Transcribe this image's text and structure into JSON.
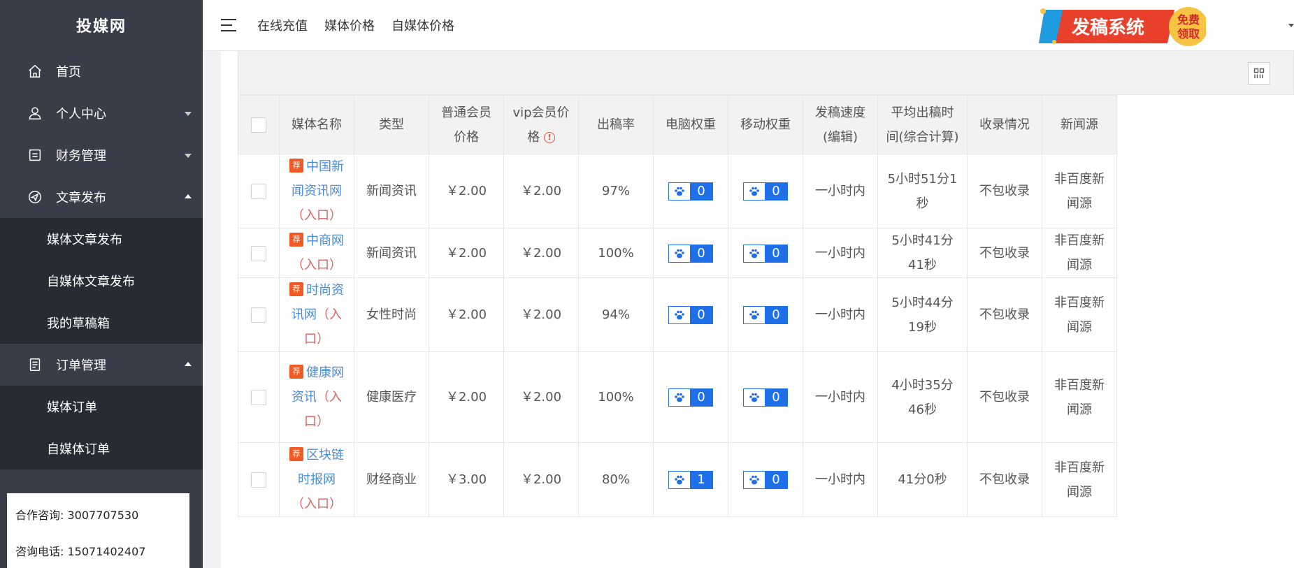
{
  "sidebar": {
    "logo": "投媒网",
    "items": [
      {
        "label": "首页"
      },
      {
        "label": "个人中心"
      },
      {
        "label": "财务管理"
      },
      {
        "label": "文章发布"
      },
      {
        "label": "订单管理"
      }
    ],
    "article_sub": [
      "媒体文章发布",
      "自媒体文章发布",
      "我的草稿箱"
    ],
    "order_sub": [
      "媒体订单",
      "自媒体订单"
    ],
    "contact": {
      "cooperation": "合作咨询: 3007707530",
      "phone": "咨询电话: 15071402407"
    }
  },
  "header": {
    "links": [
      "在线充值",
      "媒体价格",
      "自媒体价格"
    ],
    "banner": {
      "main": "发稿系统",
      "badge_line1": "免费",
      "badge_line2": "领取"
    }
  },
  "table": {
    "headers": {
      "name": "媒体名称",
      "type": "类型",
      "normal_price": "普通会员价格",
      "vip_price": "vip会员价格",
      "rate": "出稿率",
      "pc_weight": "电脑权重",
      "mobile_weight": "移动权重",
      "speed": "发稿速度(编辑)",
      "avg_time": "平均出稿时间(综合计算)",
      "indexing": "收录情况",
      "news_source": "新闻源"
    },
    "rec_badge": "荐",
    "entry_text": "（入口）",
    "rows": [
      {
        "name": "中国新闻资讯网",
        "type": "新闻资讯",
        "normal_price": "￥2.00",
        "vip_price": "￥2.00",
        "rate": "97%",
        "pc_weight": "0",
        "mobile_weight": "0",
        "speed": "一小时内",
        "avg_time": "5小时51分1秒",
        "indexing": "不包收录",
        "news_source": "非百度新闻源"
      },
      {
        "name": "中商网",
        "type": "新闻资讯",
        "normal_price": "￥2.00",
        "vip_price": "￥2.00",
        "rate": "100%",
        "pc_weight": "0",
        "mobile_weight": "0",
        "speed": "一小时内",
        "avg_time": "5小时41分41秒",
        "indexing": "不包收录",
        "news_source": "非百度新闻源"
      },
      {
        "name": "时尚资讯网",
        "type": "女性时尚",
        "normal_price": "￥2.00",
        "vip_price": "￥2.00",
        "rate": "94%",
        "pc_weight": "0",
        "mobile_weight": "0",
        "speed": "一小时内",
        "avg_time": "5小时44分19秒",
        "indexing": "不包收录",
        "news_source": "非百度新闻源"
      },
      {
        "name": "健康网资讯",
        "type": "健康医疗",
        "normal_price": "￥2.00",
        "vip_price": "￥2.00",
        "rate": "100%",
        "pc_weight": "0",
        "mobile_weight": "0",
        "speed": "一小时内",
        "avg_time": "4小时35分46秒",
        "indexing": "不包收录",
        "news_source": "非百度新闻源"
      },
      {
        "name": "区块链时报网",
        "type": "财经商业",
        "normal_price": "￥3.00",
        "vip_price": "￥2.00",
        "rate": "80%",
        "pc_weight": "1",
        "mobile_weight": "0",
        "speed": "一小时内",
        "avg_time": "41分0秒",
        "indexing": "不包收录",
        "news_source": "非百度新闻源"
      }
    ]
  },
  "colors": {
    "sidebar_bg": "#393d49",
    "sidebar_sub_bg": "#282b33",
    "link": "#4a8bd8",
    "entry": "#e06060",
    "weight_blue": "#1e6fe8",
    "rec_orange": "#f05a24"
  }
}
